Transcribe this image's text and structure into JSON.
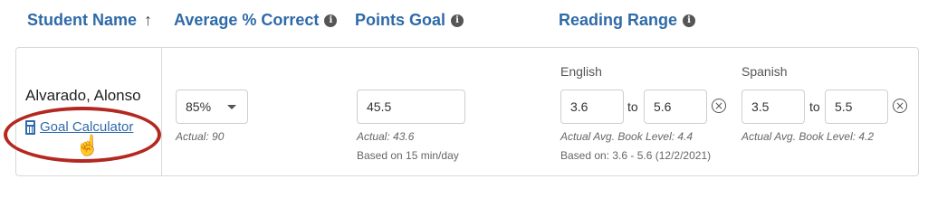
{
  "headers": {
    "student_name": "Student Name",
    "sort_indicator": "↑",
    "avg_correct": "Average % Correct",
    "points_goal": "Points Goal",
    "reading_range": "Reading Range",
    "info_icon": "i"
  },
  "row": {
    "student_name": "Alvarado, Alonso",
    "goal_calculator_label": "Goal Calculator",
    "avg_correct": {
      "selected": "85%",
      "actual": "Actual: 90"
    },
    "points_goal": {
      "value": "45.5",
      "actual": "Actual: 43.6",
      "based_on": "Based on 15 min/day"
    },
    "reading_range": {
      "english": {
        "label": "English",
        "from": "3.6",
        "to_label": "to",
        "to": "5.6",
        "avg": "Actual Avg. Book Level: 4.4",
        "based_on": "Based on: 3.6 - 5.6 (12/2/2021)"
      },
      "spanish": {
        "label": "Spanish",
        "from": "3.5",
        "to_label": "to",
        "to": "5.5",
        "avg": "Actual Avg. Book Level: 4.2"
      }
    }
  },
  "icons": {
    "info": "info-icon",
    "calculator": "calculator-icon",
    "cursor": "hand-cursor-icon",
    "clear": "clear-circle-icon",
    "dropdown": "chevron-down-icon"
  },
  "colors": {
    "link": "#2f6aa8",
    "highlight": "#b32820"
  }
}
